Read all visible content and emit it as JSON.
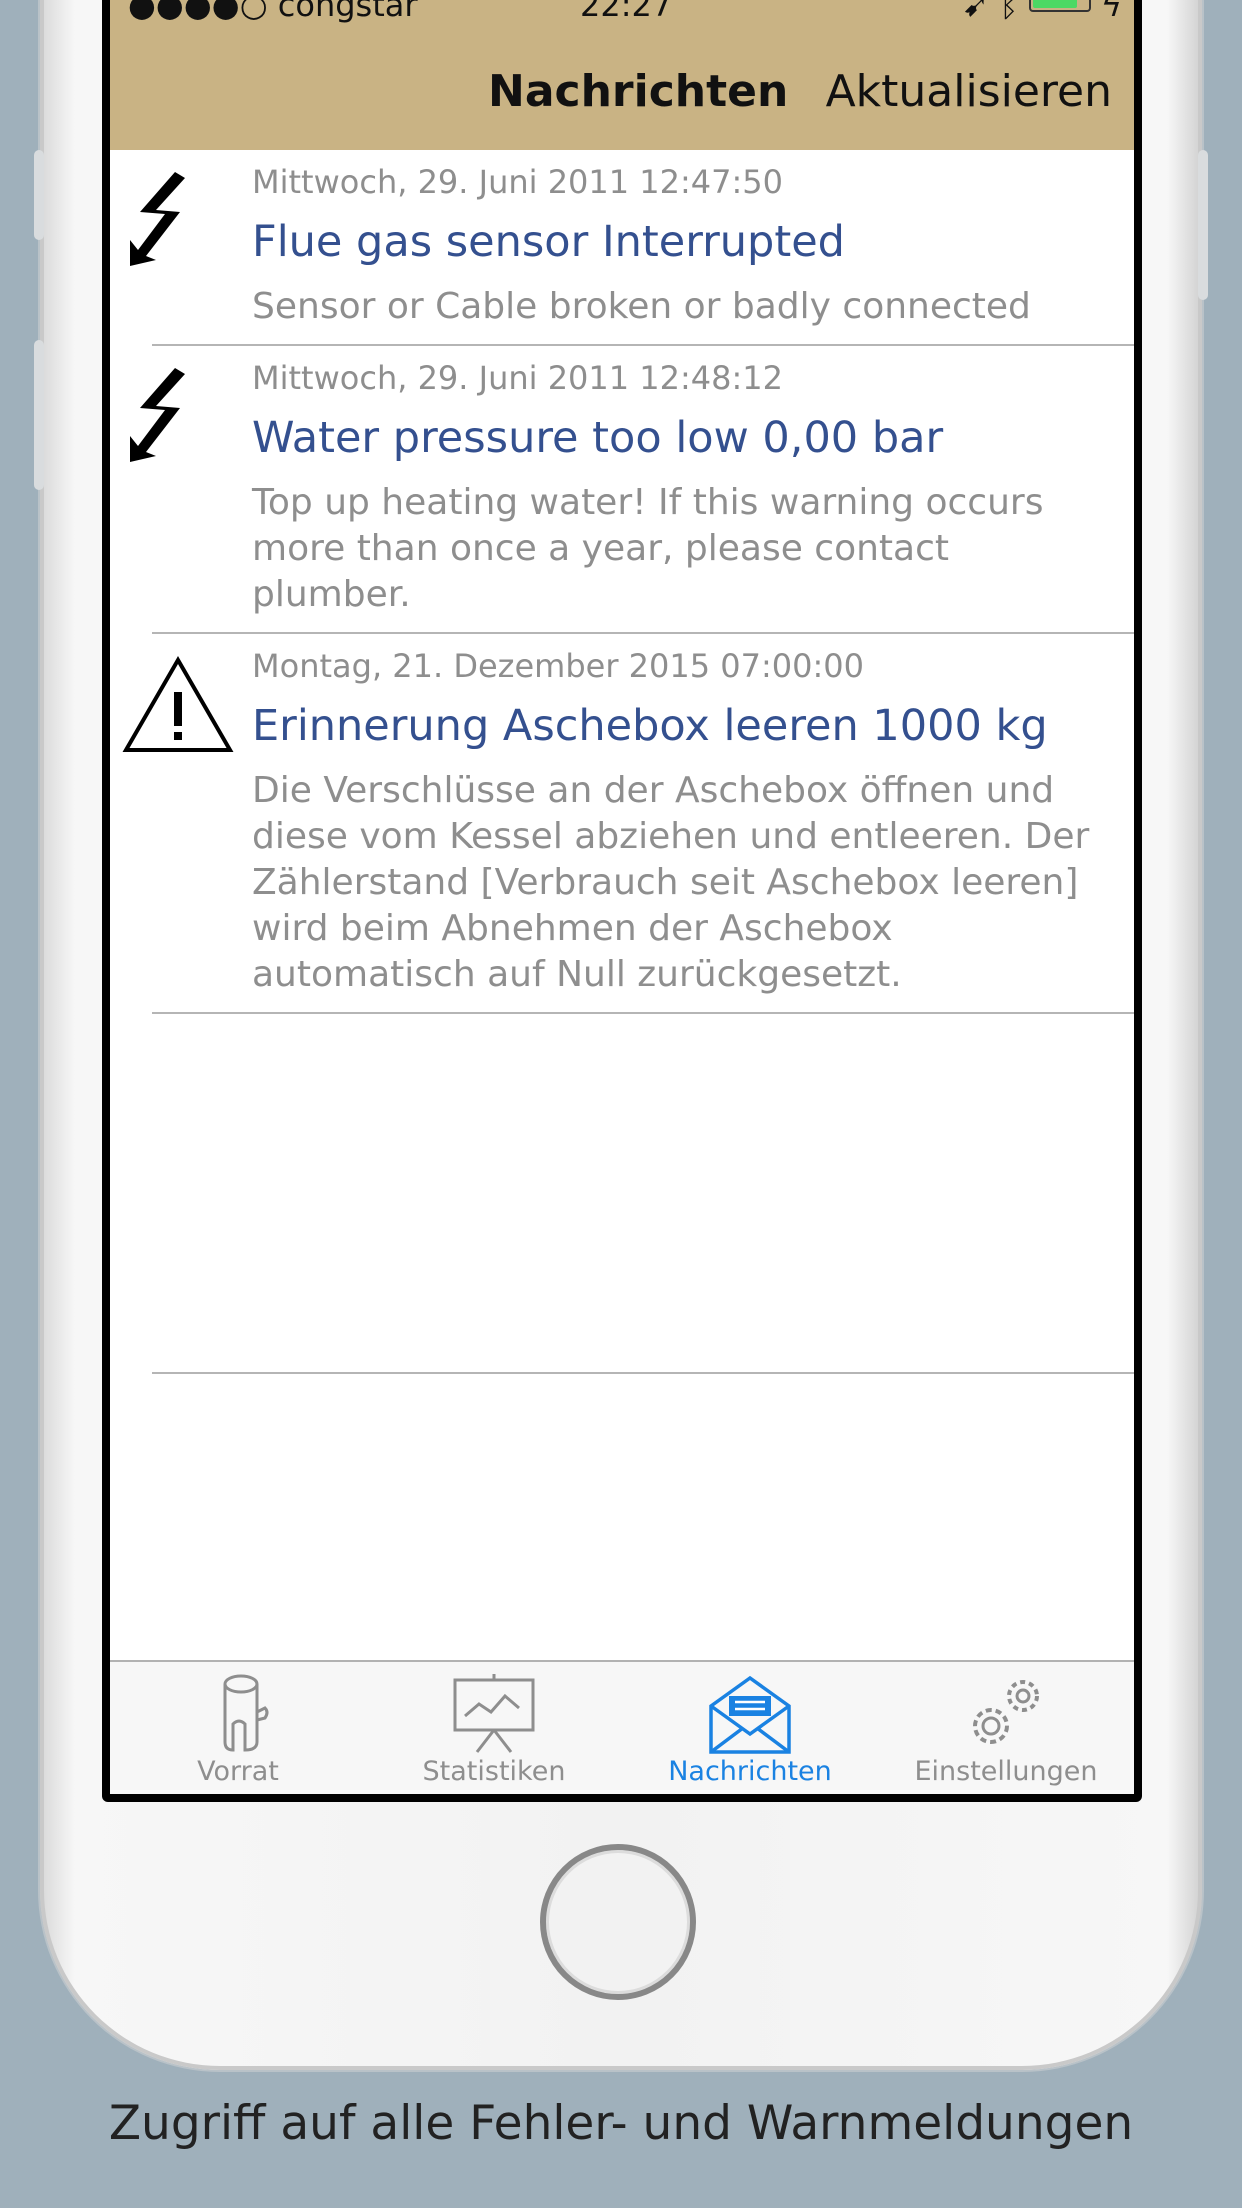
{
  "status_bar": {
    "carrier": "●●●●○ congstar",
    "time": "22:27"
  },
  "navbar": {
    "title": "Nachrichten",
    "action": "Aktualisieren"
  },
  "messages": [
    {
      "icon": "lightning-icon",
      "date": "Mittwoch, 29. Juni 2011 12:47:50",
      "title": "Flue gas sensor Interrupted",
      "description": "Sensor or Cable broken or badly connected"
    },
    {
      "icon": "lightning-icon",
      "date": "Mittwoch, 29. Juni 2011 12:48:12",
      "title": "Water pressure too low 0,00 bar",
      "description": "Top up heating water! If this warning occurs more than once a year, please contact plumber."
    },
    {
      "icon": "warning-icon",
      "date": "Montag, 21. Dezember 2015 07:00:00",
      "title": "Erinnerung Aschebox leeren 1000 kg",
      "description": "Die Verschlüsse an der Aschebox öffnen und diese vom Kessel abziehen und entleeren. Der Zählerstand [Verbrauch seit Aschebox leeren] wird beim Abnehmen der Aschebox automatisch auf Null zurückgesetzt."
    }
  ],
  "tabs": [
    {
      "label": "Vorrat",
      "icon": "logs-icon",
      "active": false
    },
    {
      "label": "Statistiken",
      "icon": "chart-board-icon",
      "active": false
    },
    {
      "label": "Nachrichten",
      "icon": "envelope-icon",
      "active": true
    },
    {
      "label": "Einstellungen",
      "icon": "gears-icon",
      "active": false
    }
  ],
  "caption": "Zugriff auf alle Fehler- und Warnmeldungen",
  "colors": {
    "navbar": "#c9b384",
    "title_blue": "#34508f",
    "tab_active": "#1a82e2",
    "background": "#9fb0bb"
  }
}
